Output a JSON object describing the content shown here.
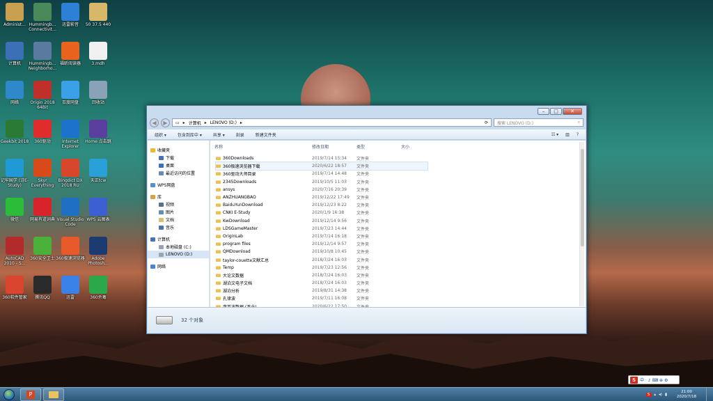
{
  "desktop_icons": [
    {
      "label": "Administ...",
      "color": "#c9a050"
    },
    {
      "label": "Hummingb... Connectivit...",
      "color": "#4a8a5a"
    },
    {
      "label": "迅雷影音",
      "color": "#2e7fd6"
    },
    {
      "label": "50 37.5 440",
      "color": "#d9b76a"
    },
    {
      "label": "计算机",
      "color": "#3b6fb6"
    },
    {
      "label": "Hummingb... Neighborho...",
      "color": "#5a7aa0"
    },
    {
      "label": "福昕阅读器",
      "color": "#e8631c"
    },
    {
      "label": "3.mdh",
      "color": "#f0f0f0"
    },
    {
      "label": "网络",
      "color": "#2f88c9"
    },
    {
      "label": "Origin 2018 64Bit",
      "color": "#c0302a"
    },
    {
      "label": "百度网盘",
      "color": "#3aa0e8"
    },
    {
      "label": "回收站",
      "color": "#8aa2b8"
    },
    {
      "label": "Geekbit 2018",
      "color": "#2a7a36"
    },
    {
      "label": "360驱动",
      "color": "#e02c2c"
    },
    {
      "label": "Internet Explorer",
      "color": "#1d73c9"
    },
    {
      "label": "Home 点击跳",
      "color": "#5a3f9e"
    },
    {
      "label": "记牢国学 (诗E-Study)",
      "color": "#1f9ad6"
    },
    {
      "label": "Skyr Everything",
      "color": "#d84a1a"
    },
    {
      "label": "Bingdict DX 2018 RU",
      "color": "#d8462c"
    },
    {
      "label": "天正tcw",
      "color": "#2aa0d8"
    },
    {
      "label": "微信",
      "color": "#2dbb3a"
    },
    {
      "label": "网易有道词典",
      "color": "#d8232a"
    },
    {
      "label": "Visual Studio Code",
      "color": "#1f6fc4"
    },
    {
      "label": "WPS 云图表",
      "color": "#3c5fd1"
    },
    {
      "label": "AutoCAD 2010 - S...",
      "color": "#b22a2a"
    },
    {
      "label": "360安全卫士",
      "color": "#49b03a"
    },
    {
      "label": "360极速浏览器",
      "color": "#e85a2a"
    },
    {
      "label": "Adobe Photosh...",
      "color": "#1c3b70"
    },
    {
      "label": "360软件管家",
      "color": "#d9452f"
    },
    {
      "label": "腾讯QQ",
      "color": "#2a2a2a"
    },
    {
      "label": "迅雷",
      "color": "#3b82e8"
    },
    {
      "label": "360杀毒",
      "color": "#2aa84a"
    }
  ],
  "window": {
    "address_parts": [
      "计算机",
      "LENOVO (D:)"
    ],
    "search_placeholder": "搜索 LENOVO (D:)",
    "toolbar": [
      "组织 ▾",
      "包含到库中 ▾",
      "共享 ▾",
      "刻录",
      "新建文件夹"
    ],
    "nav": [
      {
        "label": "收藏夹",
        "sub": false,
        "color": "#e8b83a"
      },
      {
        "label": "下载",
        "sub": true,
        "color": "#4a6fb0"
      },
      {
        "label": "桌面",
        "sub": true,
        "color": "#3a70c0"
      },
      {
        "label": "最近访问的位置",
        "sub": true,
        "color": "#6a8ab0"
      },
      {
        "gap": true
      },
      {
        "label": "WPS网盘",
        "sub": false,
        "color": "#5a8ad0"
      },
      {
        "gap": true
      },
      {
        "label": "库",
        "sub": false,
        "color": "#d8a24a"
      },
      {
        "label": "视频",
        "sub": true,
        "color": "#5b6e8a"
      },
      {
        "label": "图片",
        "sub": true,
        "color": "#6a8cb0"
      },
      {
        "label": "文档",
        "sub": true,
        "color": "#d9c07a"
      },
      {
        "label": "音乐",
        "sub": true,
        "color": "#5070a8"
      },
      {
        "gap": true
      },
      {
        "label": "计算机",
        "sub": false,
        "color": "#4a72b0"
      },
      {
        "label": "本地磁盘 (C:)",
        "sub": true,
        "color": "#9aa4b0"
      },
      {
        "label": "LENOVO (D:)",
        "sub": true,
        "color": "#9aa4b0",
        "selected": true
      },
      {
        "gap": true
      },
      {
        "label": "网络",
        "sub": false,
        "color": "#4a86c8"
      }
    ],
    "columns": [
      "名称",
      "修改日期",
      "类型",
      "大小"
    ],
    "files": [
      {
        "name": "360Downloads",
        "date": "2019/7/14 15:34",
        "type": "文件夹"
      },
      {
        "name": "360极速浏览器下载",
        "date": "2020/6/22 18:57",
        "type": "文件夹",
        "hover": true
      },
      {
        "name": "360驱动大师目录",
        "date": "2019/7/14 14:48",
        "type": "文件夹"
      },
      {
        "name": "2345Downloads",
        "date": "2019/10/5 11:03",
        "type": "文件夹"
      },
      {
        "name": "ansys",
        "date": "2020/7/16 20:39",
        "type": "文件夹"
      },
      {
        "name": "ANZHUANGBAO",
        "date": "2019/12/22 17:49",
        "type": "文件夹"
      },
      {
        "name": "BaiduYunDownload",
        "date": "2019/12/23 8:22",
        "type": "文件夹"
      },
      {
        "name": "CNKI E-Study",
        "date": "2020/1/9 16:38",
        "type": "文件夹"
      },
      {
        "name": "KwDownload",
        "date": "2019/12/14 9:56",
        "type": "文件夹"
      },
      {
        "name": "LDSGameMaster",
        "date": "2019/7/23 14:44",
        "type": "文件夹"
      },
      {
        "name": "OriginLab",
        "date": "2019/7/14 16:18",
        "type": "文件夹"
      },
      {
        "name": "program files",
        "date": "2019/12/14 9:57",
        "type": "文件夹"
      },
      {
        "name": "QMDownload",
        "date": "2019/10/8 10:45",
        "type": "文件夹"
      },
      {
        "name": "taylor-couette文献汇总",
        "date": "2018/7/24 16:03",
        "type": "文件夹"
      },
      {
        "name": "Temp",
        "date": "2019/7/23 12:56",
        "type": "文件夹"
      },
      {
        "name": "大论文数据",
        "date": "2018/7/24 16:03",
        "type": "文件夹"
      },
      {
        "name": "湖泊文电子文档",
        "date": "2018/7/24 16:03",
        "type": "文件夹"
      },
      {
        "name": "湖泊分析",
        "date": "2019/8/31 14:38",
        "type": "文件夹"
      },
      {
        "name": "孔律波",
        "date": "2019/7/11 16:08",
        "type": "文件夹"
      },
      {
        "name": "李英波数据 (不全)",
        "date": "2020/6/22 17:50",
        "type": "文件夹"
      }
    ],
    "status_count": "32 个对象"
  },
  "taskbar": {
    "clock_time": "21:00",
    "clock_date": "2020/7/18",
    "ime_text": "中 · ♪ ⌨ ⊕ ⚙"
  }
}
